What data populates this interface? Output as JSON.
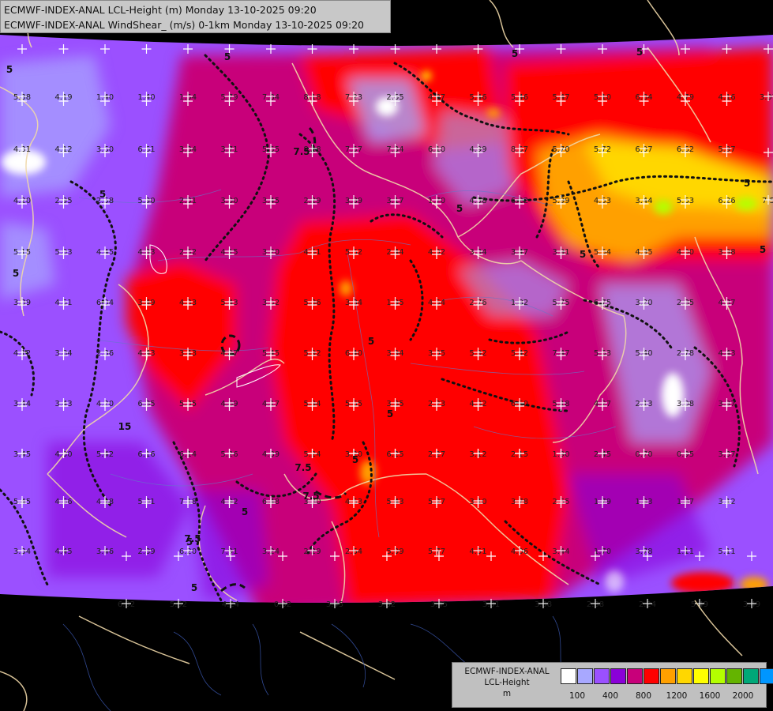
{
  "header": {
    "line1": "ECMWF-INDEX-ANAL LCL-Height (m) Monday 13-10-2025 09:20",
    "line2": "ECMWF-INDEX-ANAL WindShear_ (m/s) 0-1km Monday 13-10-2025 09:20"
  },
  "legend": {
    "title_lines": [
      "ECMWF-INDEX-ANAL",
      "LCL-Height",
      "m"
    ],
    "colors": [
      "#ffffff",
      "#a8a8ff",
      "#9b50ff",
      "#8a00d8",
      "#c8007a",
      "#ff0000",
      "#ffa000",
      "#ffd700",
      "#ffff00",
      "#b4ff00",
      "#64b400",
      "#00a878",
      "#0096ff"
    ],
    "tick_labels": [
      "100",
      "400",
      "800",
      "1200",
      "1600",
      "2000"
    ]
  },
  "contour_labels": [
    "5",
    "5",
    "5",
    "7.5",
    "5",
    "5",
    "5",
    "5",
    "5",
    "5",
    "5",
    "5",
    "5",
    "15",
    "7.5",
    "7.5",
    "5",
    "7.5",
    "5",
    "5",
    "5"
  ],
  "grid_values": [
    [
      "5.38",
      "4.19",
      "1.40",
      "1.40",
      "1.54",
      "5.79",
      "7.84",
      "8.18",
      "7.23",
      "2.65",
      "4.87",
      "5.46",
      "5.46",
      "5.47",
      "5.10",
      "6.84",
      "4.79",
      "4.16",
      "3.07"
    ],
    [
      "4.31",
      "4.12",
      "3.60",
      "6.61",
      "3.34",
      "3.71",
      "5.55",
      "8.18",
      "7.57",
      "7.34",
      "6.10",
      "4.99",
      "8.57",
      "5.70",
      "5.72",
      "6.07",
      "6.62",
      "5.97"
    ],
    [
      "4.20",
      "2.95",
      "2.58",
      "5.90",
      "2.01",
      "3.00",
      "3.45",
      "2.29",
      "3.89",
      "3.17",
      "1.70",
      "4.58",
      "6.22",
      "5.99",
      "4.53",
      "3.44",
      "5.63",
      "6.26",
      "7.5"
    ],
    [
      "5.15",
      "5.03",
      "4.45",
      "4.83",
      "2.52",
      "4.15",
      "3.20",
      "4.61",
      "5.62",
      "2.44",
      "4.02",
      "3.34",
      "3.47",
      "3.91",
      "5.54",
      "4.95",
      "4.00",
      "3.98"
    ],
    [
      "3.39",
      "4.51",
      "6.04",
      "3.49",
      "4.33",
      "5.43",
      "3.52",
      "5.86",
      "3.84",
      "1.95",
      "4.54",
      "2.76",
      "1.82",
      "5.75",
      "6.75",
      "3.20",
      "2.85",
      "4.07"
    ],
    [
      "4.12",
      "3.84",
      "2.86",
      "4.43",
      "3.43",
      "4.97",
      "5.45",
      "5.92",
      "6.40",
      "3.94",
      "3.05",
      "5.92",
      "5.42",
      "7.47",
      "5.53",
      "5.40",
      "2.78",
      "4.43"
    ],
    [
      "3.44",
      "3.43",
      "4.20",
      "6.85",
      "5.05",
      "4.69",
      "4.17",
      "5.94",
      "5.65",
      "3.85",
      "2.23",
      "4.82",
      "6.60",
      "5.18",
      "4.27",
      "2.13",
      "3.08",
      "3.97"
    ],
    [
      "3.45",
      "4.00",
      "5.42",
      "6.16",
      "6.14",
      "5.26",
      "4.89",
      "5.24",
      "3.20",
      "6.25",
      "2.27",
      "3.12",
      "2.15",
      "1.90",
      "2.45",
      "0.70",
      "0.95",
      "3.37"
    ],
    [
      "5.45",
      "4.66",
      "4.18",
      "5.01",
      "7.18",
      "4.92",
      "6.48",
      "3.30",
      "4.53",
      "5.43",
      "5.27",
      "3.10",
      "3.78",
      "2.55",
      "1.79",
      "1.93",
      "1.87",
      "3.12"
    ],
    [
      "3.34",
      "4.45",
      "3.46",
      "2.89",
      "6.20",
      "7.91",
      "3.24",
      "2.29",
      "2.64",
      "5.09",
      "5.77",
      "4.51",
      "4.06",
      "3.44",
      "1.70",
      "3.78",
      "1.11",
      "5.11"
    ],
    [
      "6.32",
      "5.52",
      "4.24",
      "0.32",
      "3.45",
      "3.82",
      "3.45",
      "3.01",
      "3.08",
      "2.38",
      "2.24",
      "5.49",
      "3.49",
      "2.32"
    ]
  ]
}
